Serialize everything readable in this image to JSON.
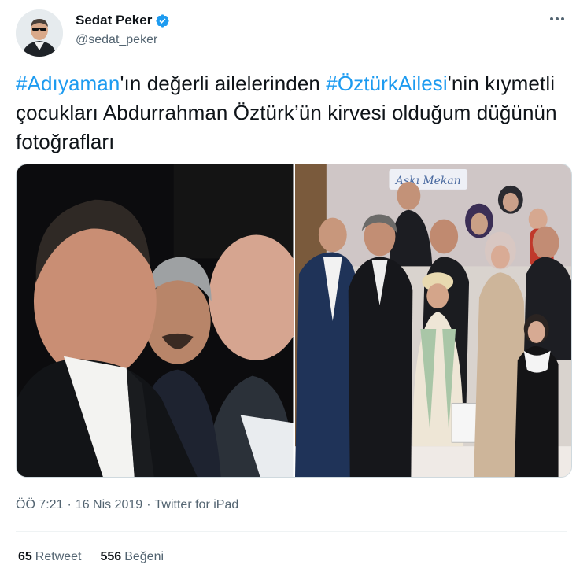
{
  "author": {
    "display_name": "Sedat Peker",
    "handle": "@sedat_peker",
    "verified": true
  },
  "tweet": {
    "segments": [
      {
        "text": "#Adıyaman",
        "hashtag": true
      },
      {
        "text": "'ın değerli ailelerinden ",
        "hashtag": false
      },
      {
        "text": "#ÖztürkAilesi",
        "hashtag": true
      },
      {
        "text": "'nin kıymetli çocukları Abdurrahman Öztürk’ün kirvesi olduğum düğünün fotoğrafları",
        "hashtag": false
      }
    ],
    "time": "ÖÖ 7:21",
    "date": "16 Nis 2019",
    "source": "Twitter for iPad",
    "separator": "·"
  },
  "media": {
    "photo_2_sign": "Aşkı Mekan"
  },
  "stats": {
    "retweets_count": "65",
    "retweets_label": "Retweet",
    "likes_count": "556",
    "likes_label": "Beğeni"
  },
  "colors": {
    "accent": "#1d9bf0",
    "text": "#0f1419",
    "muted": "#536471"
  },
  "icons": {
    "verified": "verified-badge-icon",
    "more": "more-horizontal-icon"
  }
}
